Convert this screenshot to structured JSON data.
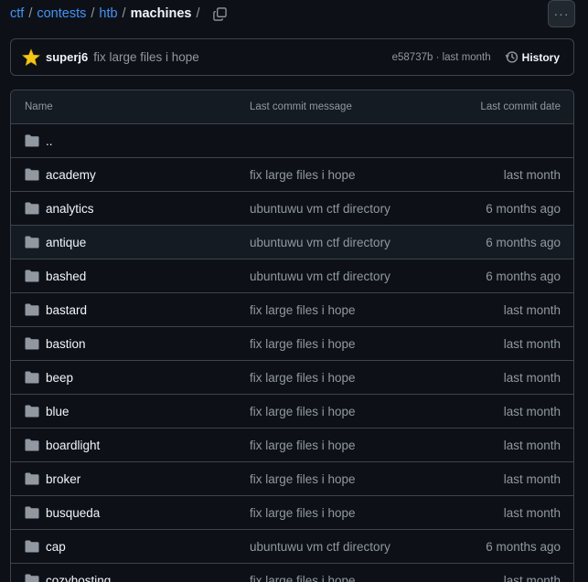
{
  "breadcrumb": {
    "items": [
      "ctf",
      "contests",
      "htb"
    ],
    "current": "machines",
    "separator": "/"
  },
  "more_button": {
    "label": "···"
  },
  "commit": {
    "author": "superj6",
    "message": "fix large files i hope",
    "meta": "e58737b · last month",
    "history_label": "History"
  },
  "table": {
    "headers": {
      "name": "Name",
      "message": "Last commit message",
      "date": "Last commit date"
    },
    "parent": "..",
    "rows": [
      {
        "name": "academy",
        "message": "fix large files i hope",
        "date": "last month"
      },
      {
        "name": "analytics",
        "message": "ubuntuwu vm ctf directory",
        "date": "6 months ago"
      },
      {
        "name": "antique",
        "message": "ubuntuwu vm ctf directory",
        "date": "6 months ago"
      },
      {
        "name": "bashed",
        "message": "ubuntuwu vm ctf directory",
        "date": "6 months ago"
      },
      {
        "name": "bastard",
        "message": "fix large files i hope",
        "date": "last month"
      },
      {
        "name": "bastion",
        "message": "fix large files i hope",
        "date": "last month"
      },
      {
        "name": "beep",
        "message": "fix large files i hope",
        "date": "last month"
      },
      {
        "name": "blue",
        "message": "fix large files i hope",
        "date": "last month"
      },
      {
        "name": "boardlight",
        "message": "fix large files i hope",
        "date": "last month"
      },
      {
        "name": "broker",
        "message": "fix large files i hope",
        "date": "last month"
      },
      {
        "name": "busqueda",
        "message": "fix large files i hope",
        "date": "last month"
      },
      {
        "name": "cap",
        "message": "ubuntuwu vm ctf directory",
        "date": "6 months ago"
      },
      {
        "name": "cozyhosting",
        "message": "fix large files i hope",
        "date": "last month"
      }
    ]
  },
  "icons": {
    "folder": "folder-icon",
    "copy": "copy-icon",
    "history": "history-icon",
    "avatar": "star-avatar"
  },
  "colors": {
    "link": "#4493f8",
    "muted": "#9198a1",
    "background": "#0d1117",
    "folder": "#9198a1",
    "avatar": "#f5c518"
  }
}
